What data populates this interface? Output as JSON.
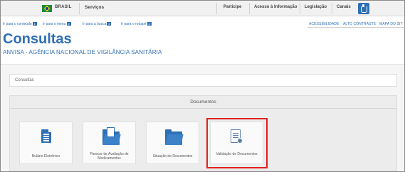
{
  "govbar": {
    "country": "BRASIL",
    "services": "Serviços",
    "links": [
      "Participe",
      "Acesso à Informação",
      "Legislação",
      "Canais"
    ]
  },
  "skiplinks": [
    {
      "label": "Ir para o conteúdo",
      "key": "1"
    },
    {
      "label": "Ir para o menu",
      "key": "2"
    },
    {
      "label": "Ir para a busca",
      "key": "3"
    },
    {
      "label": "Ir para o rodapé",
      "key": "4"
    }
  ],
  "accessibility": [
    "ACESSIBILIDADE",
    "ALTO CONTRASTE",
    "MAPA DO SIT"
  ],
  "page": {
    "title": "Consultas",
    "subtitle": "ANVISA - AGÊNCIA NACIONAL DE VIGILÂNCIA SANITÁRIA"
  },
  "breadcrumb": "Consultas",
  "section": {
    "title": "Documentos",
    "cards": [
      {
        "label": "Bulário Eletrônico",
        "icon": "document-icon"
      },
      {
        "label": "Parecer de Avaliação de Medicamentos",
        "icon": "folder-document-icon"
      },
      {
        "label": "Situação de Documentos",
        "icon": "folder-icon"
      },
      {
        "label": "Validação de Documentos",
        "icon": "document-check-icon"
      }
    ]
  },
  "colors": {
    "accent": "#2f6fb5",
    "highlight": "#e02020"
  }
}
